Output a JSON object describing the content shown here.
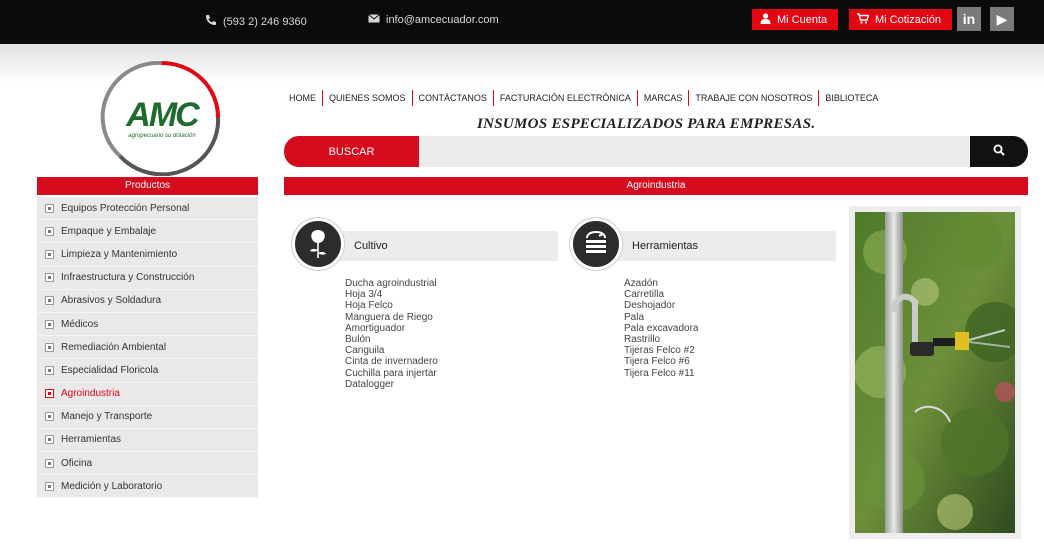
{
  "topbar": {
    "phone": "(593 2) 246 9360",
    "email": "info@amcecuador.com",
    "account_label": "Mi Cuenta",
    "quote_label": "Mi Cotización",
    "linkedin_label": "in",
    "youtube_label": "▶"
  },
  "logo": {
    "text": "AMC",
    "tagline": "agropecuario su dotación"
  },
  "nav": {
    "items": [
      "HOME",
      "QUIENES SOMOS",
      "CONTÁCTANOS",
      "FACTURACIÓN ELECTRÓNICA",
      "MARCAS",
      "TRABAJE CON NOSOTROS",
      "BIBLIOTECA"
    ]
  },
  "tagline": "INSUMOS ESPECIALIZADOS PARA EMPRESAS.",
  "search": {
    "label": "BUSCAR",
    "placeholder": ""
  },
  "sidebar": {
    "title": "Productos",
    "items": [
      "Equipos Protección Personal",
      "Empaque y Embalaje",
      "Limpieza y Mantenimiento",
      "Infraestructura y Construcción",
      "Abrasivos y Soldadura",
      "Médicos",
      "Remediación Ambiental",
      "Especialidad Floricola",
      "Agroindustria",
      "Manejo y Transporte",
      "Herramientas",
      "Oficina",
      "Medición y Laboratorio"
    ],
    "active_index": 8
  },
  "section": {
    "title": "Agroindustria"
  },
  "categories": [
    {
      "title": "Cultivo",
      "icon": "rose-icon",
      "items": [
        "Ducha agroindustrial",
        "Hoja 3/4",
        "Hoja Felco",
        "Manguera de Riego",
        "Amortiguador",
        "Bulón",
        "Canguila",
        "Cinta de invernadero",
        "Cuchilla para injertar",
        "Datalogger"
      ]
    },
    {
      "title": "Herramientas",
      "icon": "hose-reel-icon",
      "items": [
        "Azadón",
        "Carretilla",
        "Deshojador",
        "Pala",
        "Pala excavadora",
        "Rastrillo",
        "Tijeras Felco #2",
        "Tijera Felco #6",
        "Tijera Felco #11"
      ]
    }
  ],
  "colors": {
    "accent": "#d50b1e",
    "topbar": "#0b0b0b",
    "logo_green": "#1f6b2f",
    "sidebar_bg": "#e9e9e9"
  }
}
